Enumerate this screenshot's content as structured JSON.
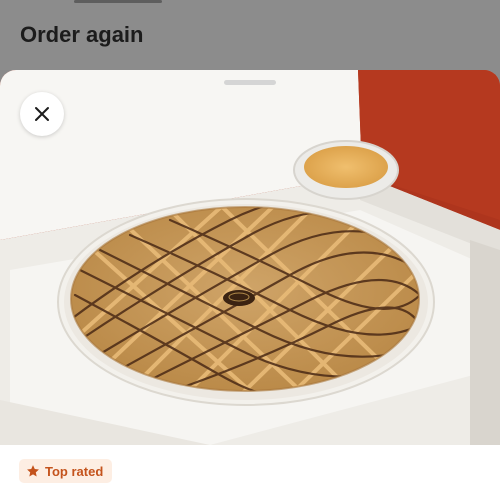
{
  "page": {
    "title": "Order again"
  },
  "sheet": {
    "close_icon": "close-icon",
    "badge": {
      "icon": "star-icon",
      "label": "Top rated",
      "color": "#c4531c"
    }
  },
  "colors": {
    "backdrop": "#8c8c8c",
    "table": "#b5391f",
    "box": "#f4f2ee",
    "crust": "#c99a5a",
    "badge_bg": "#fdeee3"
  }
}
